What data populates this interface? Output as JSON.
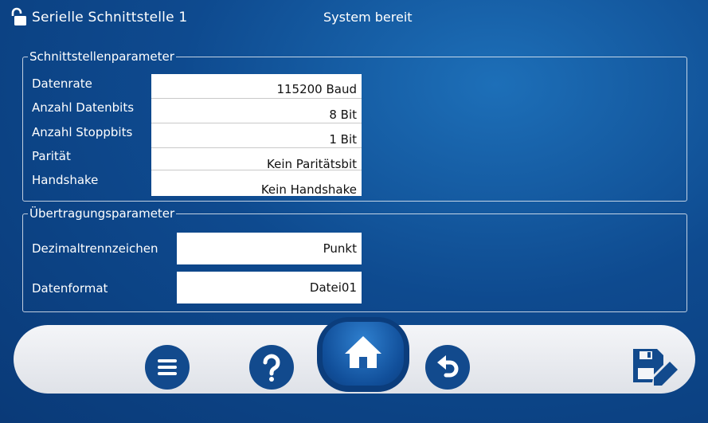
{
  "header": {
    "title": "Serielle Schnittstelle 1",
    "status": "System bereit",
    "lock_icon": "unlocked-lock-icon"
  },
  "interface_params": {
    "legend": "Schnittstellenparameter",
    "rows": [
      {
        "label": "Datenrate",
        "value": "115200 Baud"
      },
      {
        "label": "Anzahl Datenbits",
        "value": "8 Bit"
      },
      {
        "label": "Anzahl Stoppbits",
        "value": "1 Bit"
      },
      {
        "label": "Parität",
        "value": "Kein Paritätsbit"
      },
      {
        "label": "Handshake",
        "value": "Kein Handshake"
      }
    ]
  },
  "transfer_params": {
    "legend": "Übertragungsparameter",
    "rows": [
      {
        "label": "Dezimaltrennzeichen",
        "value": "Punkt"
      },
      {
        "label": "Datenformat",
        "value": "Datei01"
      }
    ]
  },
  "nav": {
    "buttons": [
      "menu-icon",
      "help-icon",
      "home-icon",
      "back-icon",
      "save-edit-icon"
    ]
  },
  "colors": {
    "background": "#0e4a8f",
    "nav_bar": "#eef0f4",
    "button_blue": "#124a8d"
  }
}
